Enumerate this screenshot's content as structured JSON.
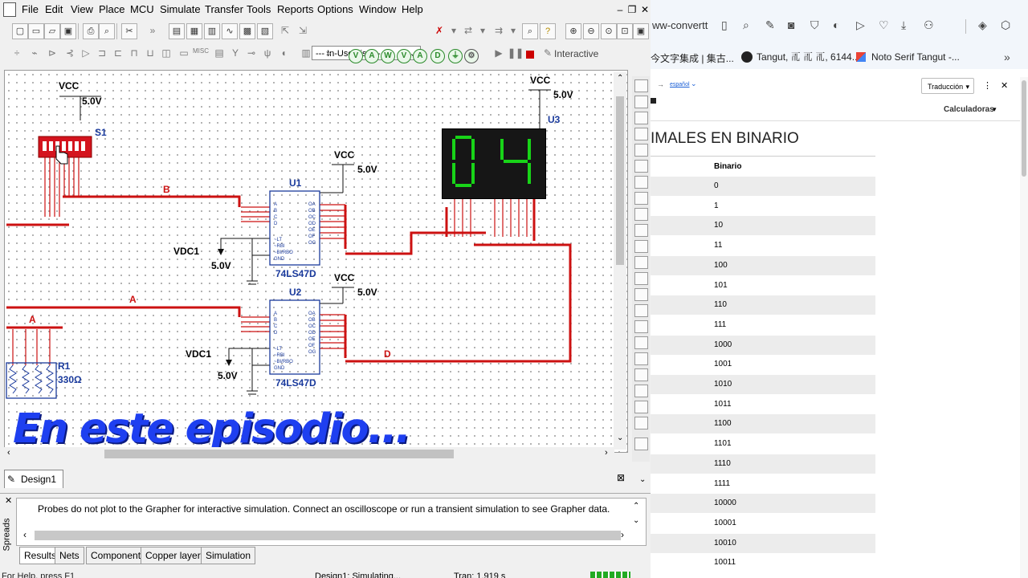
{
  "multisim": {
    "menu": [
      "File",
      "Edit",
      "View",
      "Place",
      "MCU",
      "Simulate",
      "Transfer",
      "Tools",
      "Reports",
      "Options",
      "Window",
      "Help"
    ],
    "in_use_list": "--- In-Use List ---",
    "interactive_label": "Interactive",
    "schematic": {
      "vcc": "VCC",
      "v5": "5.0V",
      "s1": "S1",
      "u1": "U1",
      "u2": "U2",
      "u3": "U3",
      "r1": "R1",
      "r1_value": "330Ω",
      "chip": "74LS47D",
      "vdc": "VDC1",
      "net_b": "B",
      "net_a": "A",
      "net_d": "D",
      "display_digits": "04",
      "overlay": "En este episodio..."
    },
    "design_tab": "Design1 *",
    "message": "Probes do not plot to the Grapher for interactive simulation. Connect an oscilloscope or run a transient simulation to see Grapher data.",
    "side_label": "Spreads",
    "bottom_tabs": [
      "Results",
      "Nets",
      "Components",
      "Copper layers",
      "Simulation"
    ],
    "status": {
      "help": "For Help, press F1",
      "sim": "Design1: Simulating...",
      "tran": "Tran: 1.919 s"
    }
  },
  "browser": {
    "url_fragment": "ww-convertt",
    "bookmarks": [
      "今文字集成 | 集古...",
      "Tangut, 𗀀 𗀀 𗀀, 6144...",
      "Noto Serif Tangut -..."
    ],
    "lang_link": "español",
    "translate_select": "Traducción",
    "calc_menu": "Calculadoras",
    "heading": "IMALES EN BINARIO",
    "column_header": "Binario",
    "binary_values": [
      "0",
      "1",
      "10",
      "11",
      "100",
      "101",
      "110",
      "111",
      "1000",
      "1001",
      "1010",
      "1011",
      "1100",
      "1101",
      "1110",
      "1111",
      "10000",
      "10001",
      "10010",
      "10011"
    ]
  },
  "colors": {
    "wire_red": "#cc1111",
    "chip_blue": "#1a3a9c",
    "seg_green": "#18d418",
    "overlay_blue": "#1e3ff0"
  }
}
